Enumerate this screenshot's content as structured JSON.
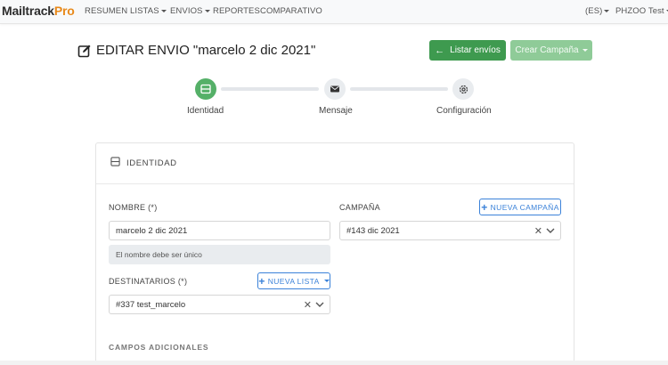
{
  "brand": {
    "name_main": "Mailtrack",
    "name_accent": "Pro"
  },
  "nav": {
    "items": [
      {
        "label": "RESUMEN"
      },
      {
        "label": "LISTAS"
      },
      {
        "label": "ENVIOS"
      },
      {
        "label": "REPORTES"
      },
      {
        "label": "COMPARATIVO"
      }
    ],
    "language": "(ES)",
    "user": "PHZOO Test"
  },
  "page": {
    "title": "EDITAR ENVIO \"marcelo 2 dic 2021\"",
    "list_button": "Listar envíos",
    "create_campaign_button": "Crear Campaña"
  },
  "stepper": {
    "steps": [
      {
        "label": "Identidad",
        "active": true
      },
      {
        "label": "Mensaje",
        "active": false
      },
      {
        "label": "Configuración",
        "active": false
      }
    ]
  },
  "card": {
    "title": "IDENTIDAD",
    "name_label": "NOMBRE (*)",
    "name_value": "marcelo 2 dic 2021",
    "name_hint": "El nombre debe ser único",
    "campaign_label": "CAMPAÑA",
    "new_campaign_button": "NUEVA CAMPAÑA",
    "campaign_value": "#143 dic 2021",
    "recipients_label": "DESTINATARIOS (*)",
    "new_list_button": "NUEVA LISTA",
    "recipients_value": "#337 test_marcelo",
    "additional_fields_label": "CAMPOS ADICIONALES"
  },
  "colors": {
    "brand_accent": "#e8891a",
    "primary_green": "#3e9a4f",
    "disabled_green": "#8fcb98",
    "active_step": "#55b068",
    "outline_blue": "#3b82d9"
  }
}
